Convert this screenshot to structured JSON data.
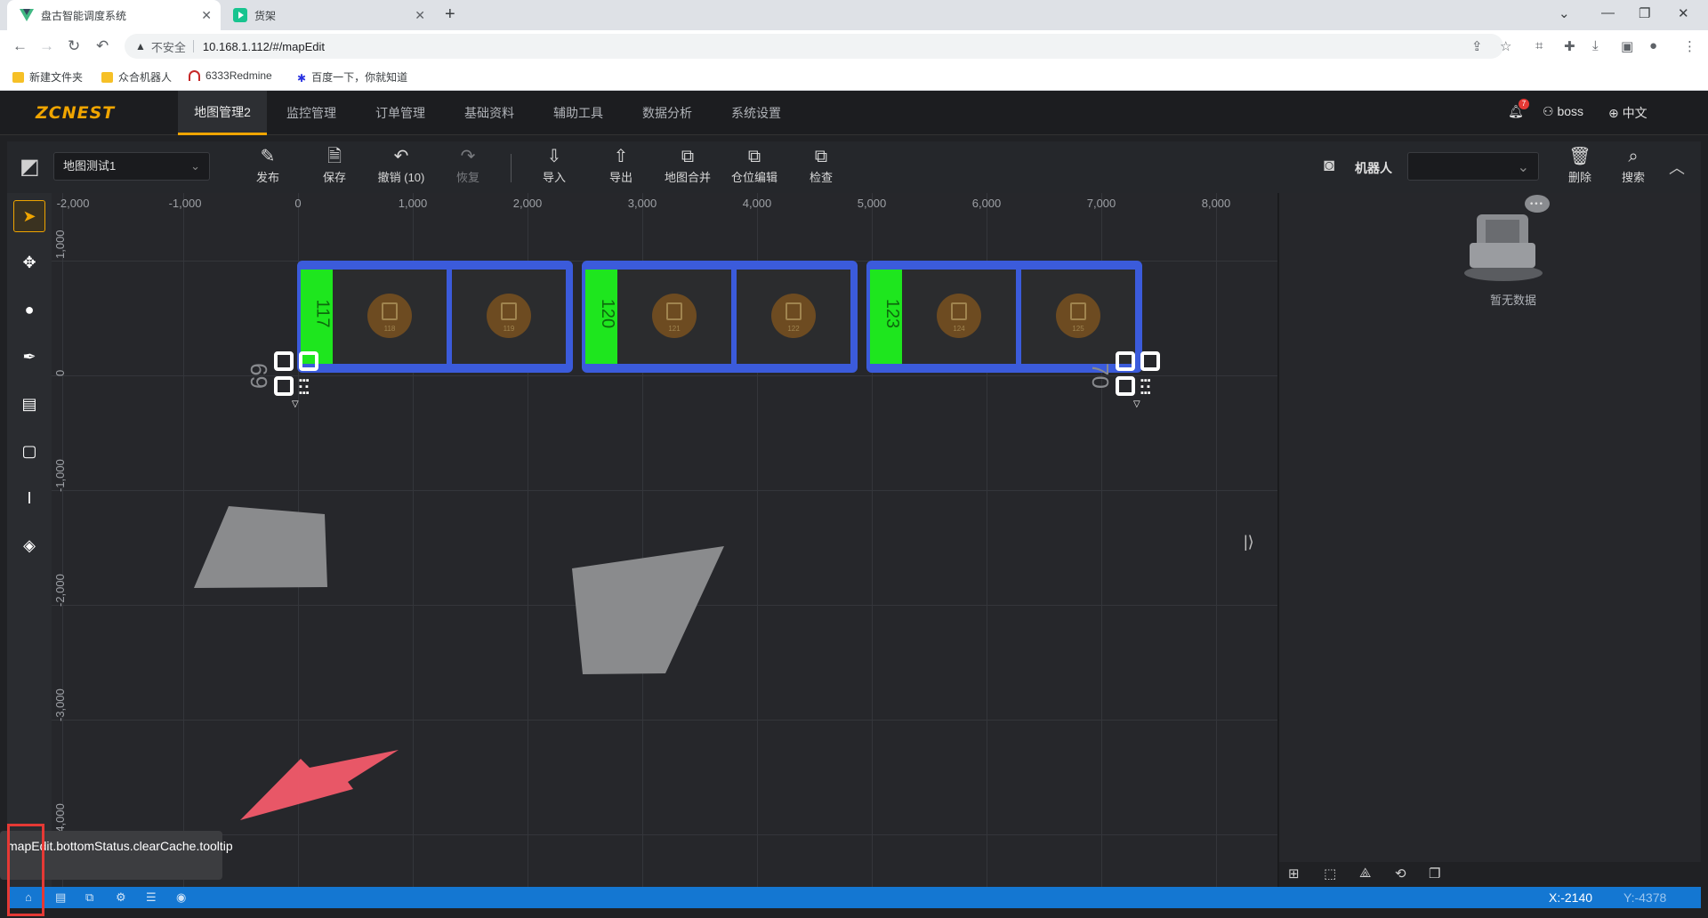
{
  "browser": {
    "tabs": [
      {
        "title": "盘古智能调度系统",
        "active": true
      },
      {
        "title": "货架",
        "active": false
      }
    ],
    "address": {
      "security_label": "不安全",
      "url": "10.168.1.112/#/mapEdit"
    },
    "bookmarks": [
      "新建文件夹",
      "众合机器人",
      "6333Redmine",
      "百度一下，你就知道"
    ]
  },
  "app": {
    "logo": "ZCNEST",
    "menu": [
      "地图管理2",
      "监控管理",
      "订单管理",
      "基础资料",
      "辅助工具",
      "数据分析",
      "系统设置"
    ],
    "active_menu": "地图管理2",
    "notification_count": "7",
    "user": "boss",
    "language": "中文"
  },
  "toolbar": {
    "map_name": "地图测试1",
    "buttons": [
      {
        "label": "发布",
        "icon": "edit-icon"
      },
      {
        "label": "保存",
        "icon": "save-icon"
      },
      {
        "label": "撤销 (10)",
        "icon": "undo-icon"
      },
      {
        "label": "恢复",
        "icon": "redo-icon"
      },
      {
        "label": "导入",
        "icon": "import-icon"
      },
      {
        "label": "导出",
        "icon": "export-icon"
      },
      {
        "label": "地图合并",
        "icon": "merge-icon"
      },
      {
        "label": "仓位编辑",
        "icon": "slot-edit-icon"
      },
      {
        "label": "检查",
        "icon": "check-icon"
      }
    ],
    "robot_label": "机器人",
    "delete_label": "删除",
    "search_label": "搜索"
  },
  "canvas": {
    "x_ticks": [
      "-2,000",
      "-1,000",
      "0",
      "1,000",
      "2,000",
      "3,000",
      "4,000",
      "5,000",
      "6,000",
      "7,000",
      "8,000"
    ],
    "y_ticks": [
      "1,000",
      "0",
      "-1,000",
      "-2,000",
      "-3,000",
      "-4,000"
    ],
    "rack_groups": [
      {
        "head": "117",
        "cells": [
          "118",
          "119"
        ]
      },
      {
        "head": "120",
        "cells": [
          "121",
          "122"
        ]
      },
      {
        "head": "123",
        "cells": [
          "124",
          "125"
        ]
      }
    ],
    "point_labels": [
      "69",
      "70"
    ]
  },
  "right_panel": {
    "empty_text": "暂无数据"
  },
  "tooltip": "mapEdit.bottomStatus.clearCache.tooltip",
  "status": {
    "x": "X:-2140",
    "y": "Y:-4378"
  }
}
